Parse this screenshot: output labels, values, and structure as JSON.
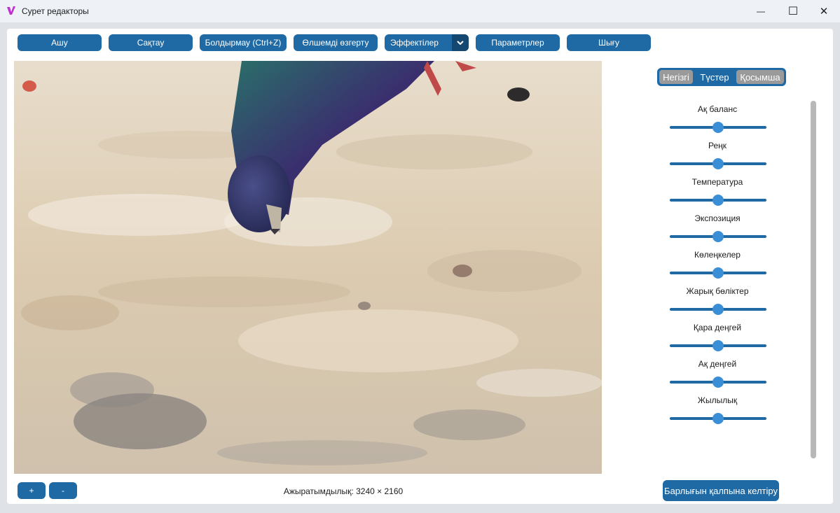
{
  "window": {
    "title": "Сурет редакторы",
    "minimize_glyph": "—",
    "maximize_glyph": "☐",
    "close_glyph": "✕"
  },
  "toolbar": {
    "open_label": "Ашу",
    "save_label": "Сақтау",
    "undo_label": "Болдырмау (Ctrl+Z)",
    "resize_label": "Өлшемді өзгерту",
    "effects_selected": "Эффектілер",
    "settings_label": "Параметрлер",
    "exit_label": "Шығу"
  },
  "tabs": [
    "Негізгі",
    "Түстер",
    "Қосымша"
  ],
  "active_tab": "Түстер",
  "sliders": [
    {
      "label": "Ақ баланс",
      "value": 0.5
    },
    {
      "label": "Реңк",
      "value": 0.5
    },
    {
      "label": "Температура",
      "value": 0.5
    },
    {
      "label": "Экспозиция",
      "value": 0.5
    },
    {
      "label": "Көлеңкелер",
      "value": 0.5
    },
    {
      "label": "Жарық бөліктер",
      "value": 0.5
    },
    {
      "label": "Қара деңгей",
      "value": 0.5
    },
    {
      "label": "Ақ деңгей",
      "value": 0.5
    },
    {
      "label": "Жылылық",
      "value": 0.5
    }
  ],
  "zoom": {
    "in_label": "+",
    "out_label": "-"
  },
  "status": {
    "resolution": "Ажыратымдылық: 3240 × 2160"
  },
  "reset_label": "Барлығын қалпына келтіру",
  "colors": {
    "accent": "#1f6aa5",
    "accent_dark": "#144870",
    "knob": "#3a8ed6",
    "inactive_tab": "#9a9a9a"
  }
}
